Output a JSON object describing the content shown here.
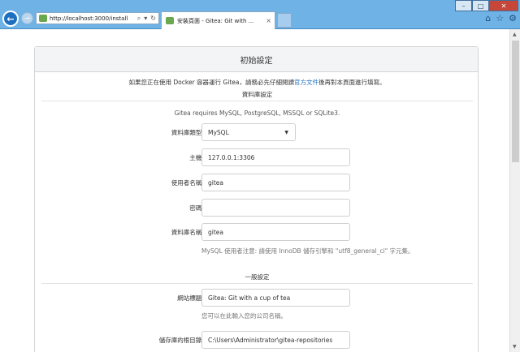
{
  "browser": {
    "url": "http://localhost:3000/install",
    "tab_title": "安裝頁面 - Gitea: Git with ...",
    "window_controls": [
      "minimize",
      "maximize",
      "close"
    ]
  },
  "page": {
    "header": "初始設定",
    "notice_prefix": "如果您正在使用 Docker 容器運行 Gitea，請務必先仔細閱讀",
    "notice_link": "官方文件",
    "notice_suffix": "後再對本頁面進行填寫。",
    "db_section": {
      "title": "資料庫設定",
      "hint": "Gitea requires MySQL, PostgreSQL, MSSQL or SQLite3.",
      "db_type_label": "資料庫類型",
      "db_type_value": "MySQL",
      "host_label": "主機",
      "host_value": "127.0.0.1:3306",
      "user_label": "使用者名稱",
      "user_value": "gitea",
      "password_label": "密碼",
      "password_value": "",
      "dbname_label": "資料庫名稱",
      "dbname_value": "gitea",
      "dbname_help": "MySQL 使用者注意: 請使用 InnoDB 儲存引擎和 \"utf8_general_ci\" 字元集。"
    },
    "general_section": {
      "title": "一般設定",
      "site_title_label": "網站標題",
      "site_title_value": "Gitea: Git with a cup of tea",
      "site_title_help": "您可以在此輸入您的公司名稱。",
      "repo_root_label": "儲存庫的根目錄",
      "repo_root_value": "C:\\Users\\Administrator\\gitea-repositories"
    }
  },
  "colors": {
    "titlebar": "#6fb2e6",
    "link": "#1e70bf",
    "required": "#db2828"
  }
}
